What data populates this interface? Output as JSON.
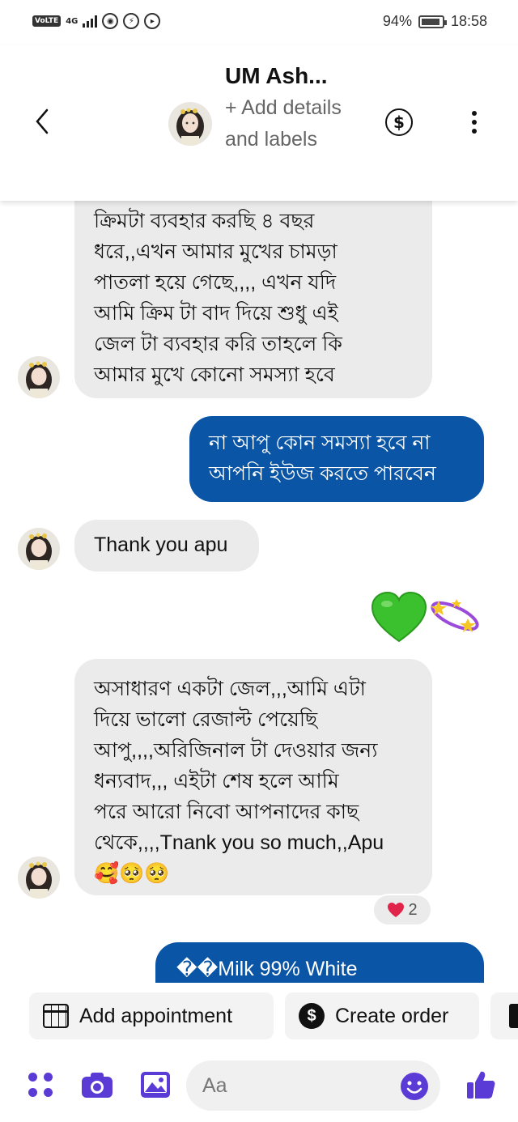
{
  "status_bar": {
    "volte": "VoLTE",
    "network": "4G",
    "battery": "94%",
    "time": "18:58"
  },
  "header": {
    "contact_name": "UM Ash...",
    "add_details": "+ Add details and labels"
  },
  "messages": [
    {
      "direction": "in",
      "text": "ক্রিমটা ব্যবহার করছি ৪ বছর\nধরে,,এখন আমার মুখের চামড়া\nপাতলা হয়ে গেছে,,,, এখন যদি\nআমি ক্রিম টা বাদ দিয়ে শুধু এই\nজেল টা ব্যবহার করি তাহলে কি\nআমার মুখে কোনো সমস্যা হবে"
    },
    {
      "direction": "out",
      "text": "না আপু কোন সমস্যা হবে না\nআপনি ইউজ করতে পারবেন"
    },
    {
      "direction": "in",
      "text": "Thank you apu"
    },
    {
      "direction": "out",
      "emoji": [
        "green-heart",
        "dizzy-stars"
      ]
    },
    {
      "direction": "in",
      "text": "অসাধারণ একটা জেল,,,আমি এটা\nদিয়ে ভালো রেজাল্ট পেয়েছি\nআপু,,,,অরিজিনাল টা দেওয়ার জন্য\nধন্যবাদ,,, এইটা শেষ হলে আমি\nপরে আরো নিবো আপনাদের কাছ\nথেকে,,,,Tnank you so much,,Apu\n🥰🥺🥺",
      "reaction": {
        "emoji": "red-heart",
        "count": "2"
      }
    },
    {
      "direction": "out",
      "text": "��Milk 99% White"
    }
  ],
  "quick_actions": [
    {
      "label": "Add appointment",
      "icon": "calendar-icon"
    },
    {
      "label": "Create order",
      "icon": "dollar-icon"
    }
  ],
  "composer": {
    "placeholder": "Aa"
  },
  "colors": {
    "outgoing_bubble": "#0a55a5",
    "incoming_bubble": "#ebebeb",
    "accent": "#5b3bd6"
  }
}
